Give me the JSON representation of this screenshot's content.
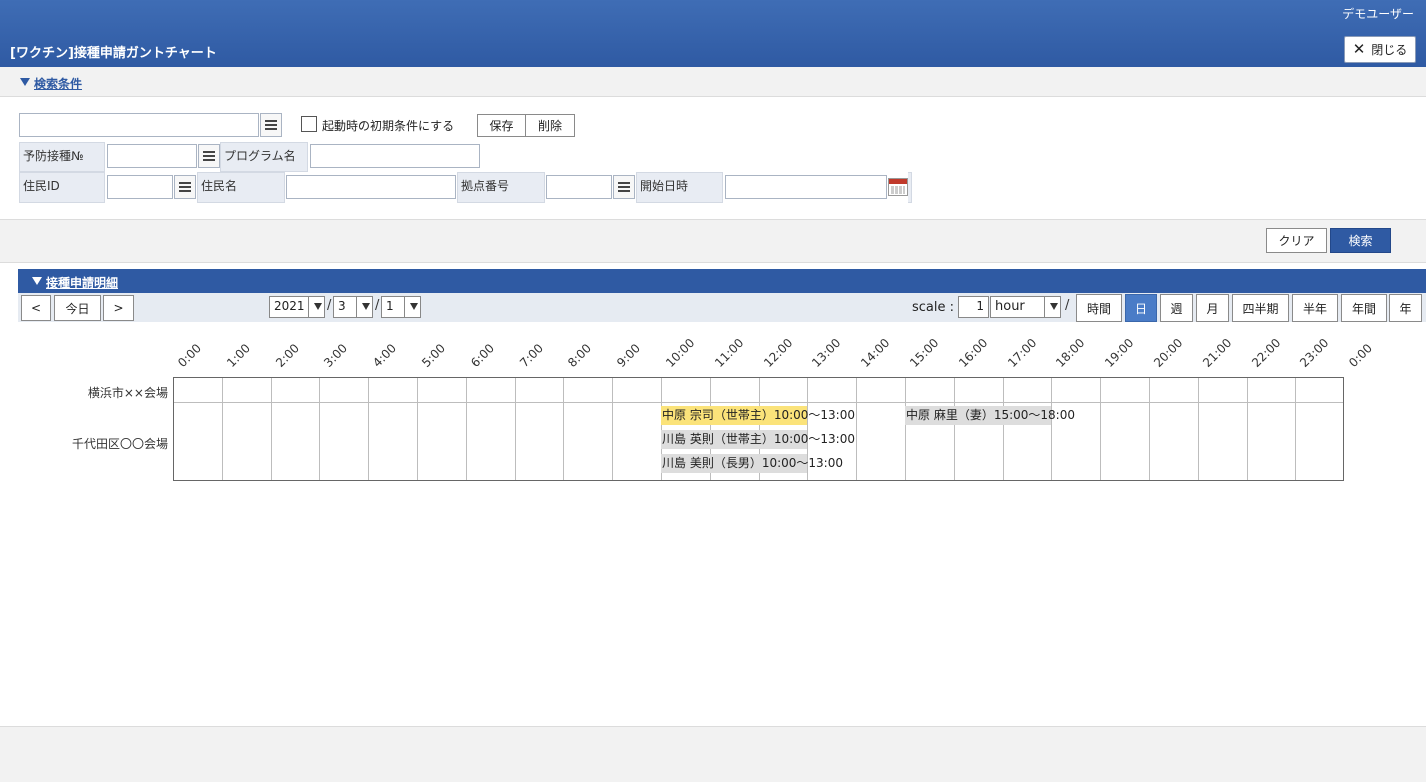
{
  "header": {
    "user": "デモユーザー",
    "title": "[ワクチン]接種申請ガントチャート",
    "close_label": "閉じる"
  },
  "search": {
    "section_label": "検索条件",
    "preset_value": "",
    "startup_checkbox_label": "起動時の初期条件にする",
    "save_label": "保存",
    "delete_label": "削除",
    "vaccination_no_label": "予防接種№",
    "program_name_label": "プログラム名",
    "resident_id_label": "住民ID",
    "resident_name_label": "住民名",
    "site_no_label": "拠点番号",
    "start_datetime_label": "開始日時",
    "clear_label": "クリア",
    "search_label": "検索"
  },
  "detail": {
    "section_label": "接種申請明細",
    "prev_label": "<",
    "today_label": "今日",
    "next_label": ">",
    "year": "2021",
    "month": "3",
    "day": "1",
    "scale_label": "scale :",
    "scale_value": "1",
    "scale_unit": "hour",
    "views": [
      "時間",
      "日",
      "週",
      "月",
      "四半期",
      "半年",
      "年間",
      "年"
    ],
    "active_view": "日"
  },
  "gantt": {
    "hours": [
      "0:00",
      "1:00",
      "2:00",
      "3:00",
      "4:00",
      "5:00",
      "6:00",
      "7:00",
      "8:00",
      "9:00",
      "10:00",
      "11:00",
      "12:00",
      "13:00",
      "14:00",
      "15:00",
      "16:00",
      "17:00",
      "18:00",
      "19:00",
      "20:00",
      "21:00",
      "22:00",
      "23:00",
      "0:00"
    ],
    "rows": [
      "横浜市××会場",
      "千代田区〇〇会場"
    ],
    "bars": [
      {
        "row": 1,
        "lane": 0,
        "start": 10,
        "end": 13,
        "label": "中原 宗司（世帯主）10:00～13:00",
        "color": "#fbe37a"
      },
      {
        "row": 1,
        "lane": 1,
        "start": 10,
        "end": 13,
        "label": "川島 英則（世帯主）10:00～13:00",
        "color": "#dddddd"
      },
      {
        "row": 1,
        "lane": 2,
        "start": 10,
        "end": 13,
        "label": "川島 美則（長男）10:00～13:00",
        "color": "#dddddd"
      },
      {
        "row": 1,
        "lane": 0,
        "start": 15,
        "end": 18,
        "label": "中原 麻里（妻）15:00～18:00",
        "color": "#dddddd"
      }
    ]
  }
}
